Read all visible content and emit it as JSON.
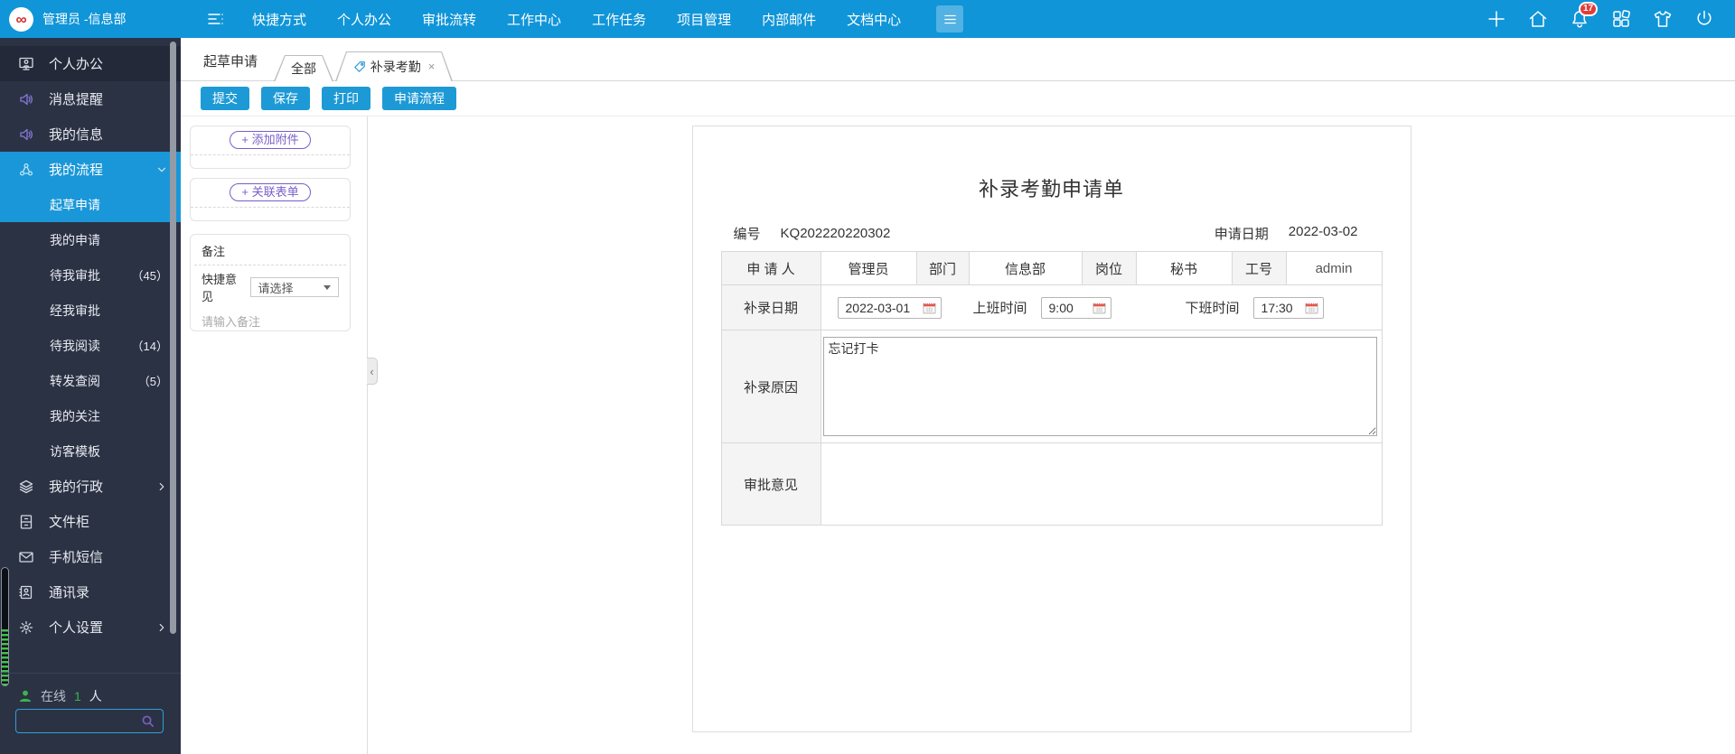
{
  "colors": {
    "accent": "#1095d8",
    "sidebar_bg": "#2b3244",
    "active_item": "#1a97d8",
    "purple": "#7a5ec8",
    "green": "#3bb54a",
    "badge_red": "#e23c39"
  },
  "topbar": {
    "logo_glyph": "∞",
    "user": "管理员 -信息部",
    "nav": [
      {
        "id": "shortcut",
        "label": "快捷方式"
      },
      {
        "id": "personal-office",
        "label": "个人办公"
      },
      {
        "id": "approval-flow",
        "label": "审批流转"
      },
      {
        "id": "work-center",
        "label": "工作中心"
      },
      {
        "id": "work-task",
        "label": "工作任务"
      },
      {
        "id": "project-mgmt",
        "label": "项目管理"
      },
      {
        "id": "internal-mail",
        "label": "内部邮件"
      },
      {
        "id": "doc-center",
        "label": "文档中心"
      }
    ],
    "right_icons": [
      {
        "id": "add",
        "icon": "plus-icon"
      },
      {
        "id": "home",
        "icon": "home-icon"
      },
      {
        "id": "notifications",
        "icon": "bell-icon",
        "badge": "17"
      },
      {
        "id": "apps",
        "icon": "apps-icon"
      },
      {
        "id": "theme",
        "icon": "shirt-icon"
      },
      {
        "id": "logout",
        "icon": "power-icon"
      }
    ]
  },
  "sidebar": {
    "items": [
      {
        "id": "personal-office",
        "label": "个人办公",
        "icon": "monitor-user-icon",
        "header": true
      },
      {
        "id": "message-remind",
        "label": "消息提醒",
        "icon": "speaker-icon",
        "icon_color": "purple"
      },
      {
        "id": "my-info",
        "label": "我的信息",
        "icon": "speaker-icon",
        "icon_color": "purple"
      },
      {
        "id": "my-flow",
        "label": "我的流程",
        "icon": "flow-icon",
        "icon_color": "flow",
        "active": true,
        "arrow": "down"
      },
      {
        "id": "draft-apply",
        "label": "起草申请",
        "child": true,
        "active": true
      },
      {
        "id": "my-apply",
        "label": "我的申请",
        "child": true
      },
      {
        "id": "await-my-approval",
        "label": "待我审批",
        "child": true,
        "count": "（45）"
      },
      {
        "id": "approved-by-me",
        "label": "经我审批",
        "child": true
      },
      {
        "id": "await-my-read",
        "label": "待我阅读",
        "child": true,
        "count": "（14）"
      },
      {
        "id": "forward-review",
        "label": "转发查阅",
        "child": true,
        "count": "（5）"
      },
      {
        "id": "my-follow",
        "label": "我的关注",
        "child": true
      },
      {
        "id": "visitor-template",
        "label": "访客模板",
        "child": true
      },
      {
        "id": "my-admin",
        "label": "我的行政",
        "icon": "layers-icon",
        "arrow": "right"
      },
      {
        "id": "file-cabinet",
        "label": "文件柜",
        "icon": "cabinet-icon"
      },
      {
        "id": "sms",
        "label": "手机短信",
        "icon": "mail-icon"
      },
      {
        "id": "contacts",
        "label": "通讯录",
        "icon": "contacts-icon"
      },
      {
        "id": "personal-settings",
        "label": "个人设置",
        "icon": "gear-icon",
        "arrow": "right"
      }
    ],
    "online": {
      "label": "在线",
      "count": "1",
      "suffix": "人"
    }
  },
  "tabs": {
    "context_label": "起草申请",
    "all": {
      "label": "全部"
    },
    "active": {
      "label": "补录考勤",
      "close": "×"
    }
  },
  "toolbar": {
    "buttons": [
      {
        "id": "submit",
        "label": "提交"
      },
      {
        "id": "save",
        "label": "保存"
      },
      {
        "id": "print",
        "label": "打印"
      },
      {
        "id": "apply-flow",
        "label": "申请流程"
      }
    ]
  },
  "attachments_panel": {
    "add_attachment": "+ 添加附件",
    "link_form": "+ 关联表单",
    "note_title": "备注",
    "quick_opinion_label": "快捷意见",
    "quick_opinion_value": "请选择",
    "note_placeholder": "请输入备注",
    "collapse_glyph": "‹"
  },
  "form": {
    "title": "补录考勤申请单",
    "number_label": "编号",
    "number": "KQ202220220302",
    "date_label": "申请日期",
    "date": "2022-03-02",
    "table": {
      "applicant_label": "申 请 人",
      "applicant": "管理员",
      "dept_label": "部门",
      "dept": "信息部",
      "position_label": "岗位",
      "position": "秘书",
      "jobno_label": "工号",
      "jobno": "admin",
      "makeup_date_label": "补录日期",
      "makeup_date": "2022-03-01",
      "start_label": "上班时间",
      "start": "9:00",
      "end_label": "下班时间",
      "end": "17:30",
      "reason_label": "补录原因",
      "reason": "忘记打卡",
      "approval_label": "审批意见",
      "approval": ""
    }
  }
}
